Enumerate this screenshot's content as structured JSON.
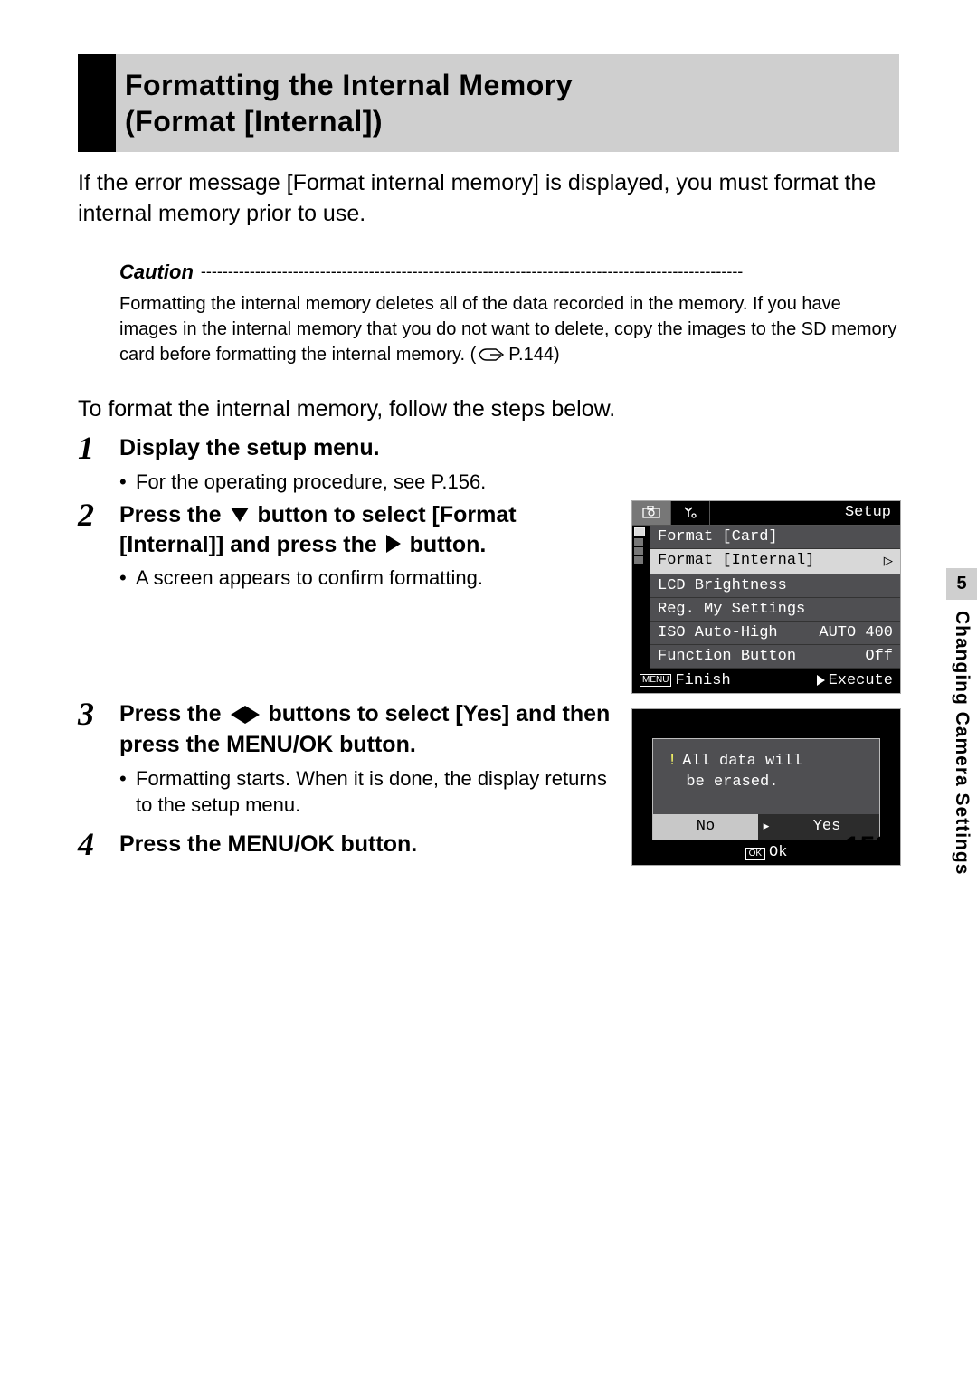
{
  "heading": {
    "line1": "Formatting the Internal Memory",
    "line2": "(Format [Internal])"
  },
  "intro": "If the error message [Format internal memory] is displayed, you must format the internal memory prior to use.",
  "caution": {
    "label": "Caution",
    "dashes": "----------------------------------------------------------------------------------------------------",
    "body_a": "Formatting the internal memory deletes all of the data recorded in the memory. If you have images in the internal memory that you do not want to delete, copy the images to the SD memory card before formatting the internal memory. (",
    "page_ref": "P.144)",
    "icon_name": "caution-icon",
    "ref_icon": "page-ref-icon"
  },
  "lead": "To format the internal memory, follow the steps below.",
  "steps": [
    {
      "num": "1",
      "title": "Display the setup menu.",
      "bullet": "For the operating procedure, see P.156."
    },
    {
      "num": "2",
      "title_a": "Press the ",
      "title_b": " button to select [Format [Internal]] and press the ",
      "title_c": " button.",
      "bullet": "A screen appears to confirm formatting."
    },
    {
      "num": "3",
      "title_a": "Press the ",
      "title_b": " buttons to select [Yes] and then press the MENU/OK button.",
      "bullet": "Formatting starts. When it is done, the display returns to the setup menu."
    },
    {
      "num": "4",
      "title": "Press the MENU/OK button."
    }
  ],
  "lcd_menu": {
    "tab_setup": "Setup",
    "rows": [
      {
        "label": "Format [Card]",
        "value": ""
      },
      {
        "label": "Format [Internal]",
        "value": "▷",
        "selected": true
      },
      {
        "label": "LCD Brightness",
        "value": ""
      },
      {
        "label": "Reg. My Settings",
        "value": ""
      },
      {
        "label": "ISO Auto-High",
        "value": "AUTO 400"
      },
      {
        "label": "Function Button",
        "value": "Off"
      }
    ],
    "foot_menu_box": "MENU",
    "foot_left": "Finish",
    "foot_right": "Execute"
  },
  "confirm": {
    "msg_line1": "All data will",
    "msg_line2": "be erased.",
    "no": "No",
    "yes": "Yes",
    "ok_box": "OK",
    "ok_label": "Ok"
  },
  "side_tab": {
    "num": "5",
    "text": "Changing Camera Settings"
  },
  "page_number": "159"
}
